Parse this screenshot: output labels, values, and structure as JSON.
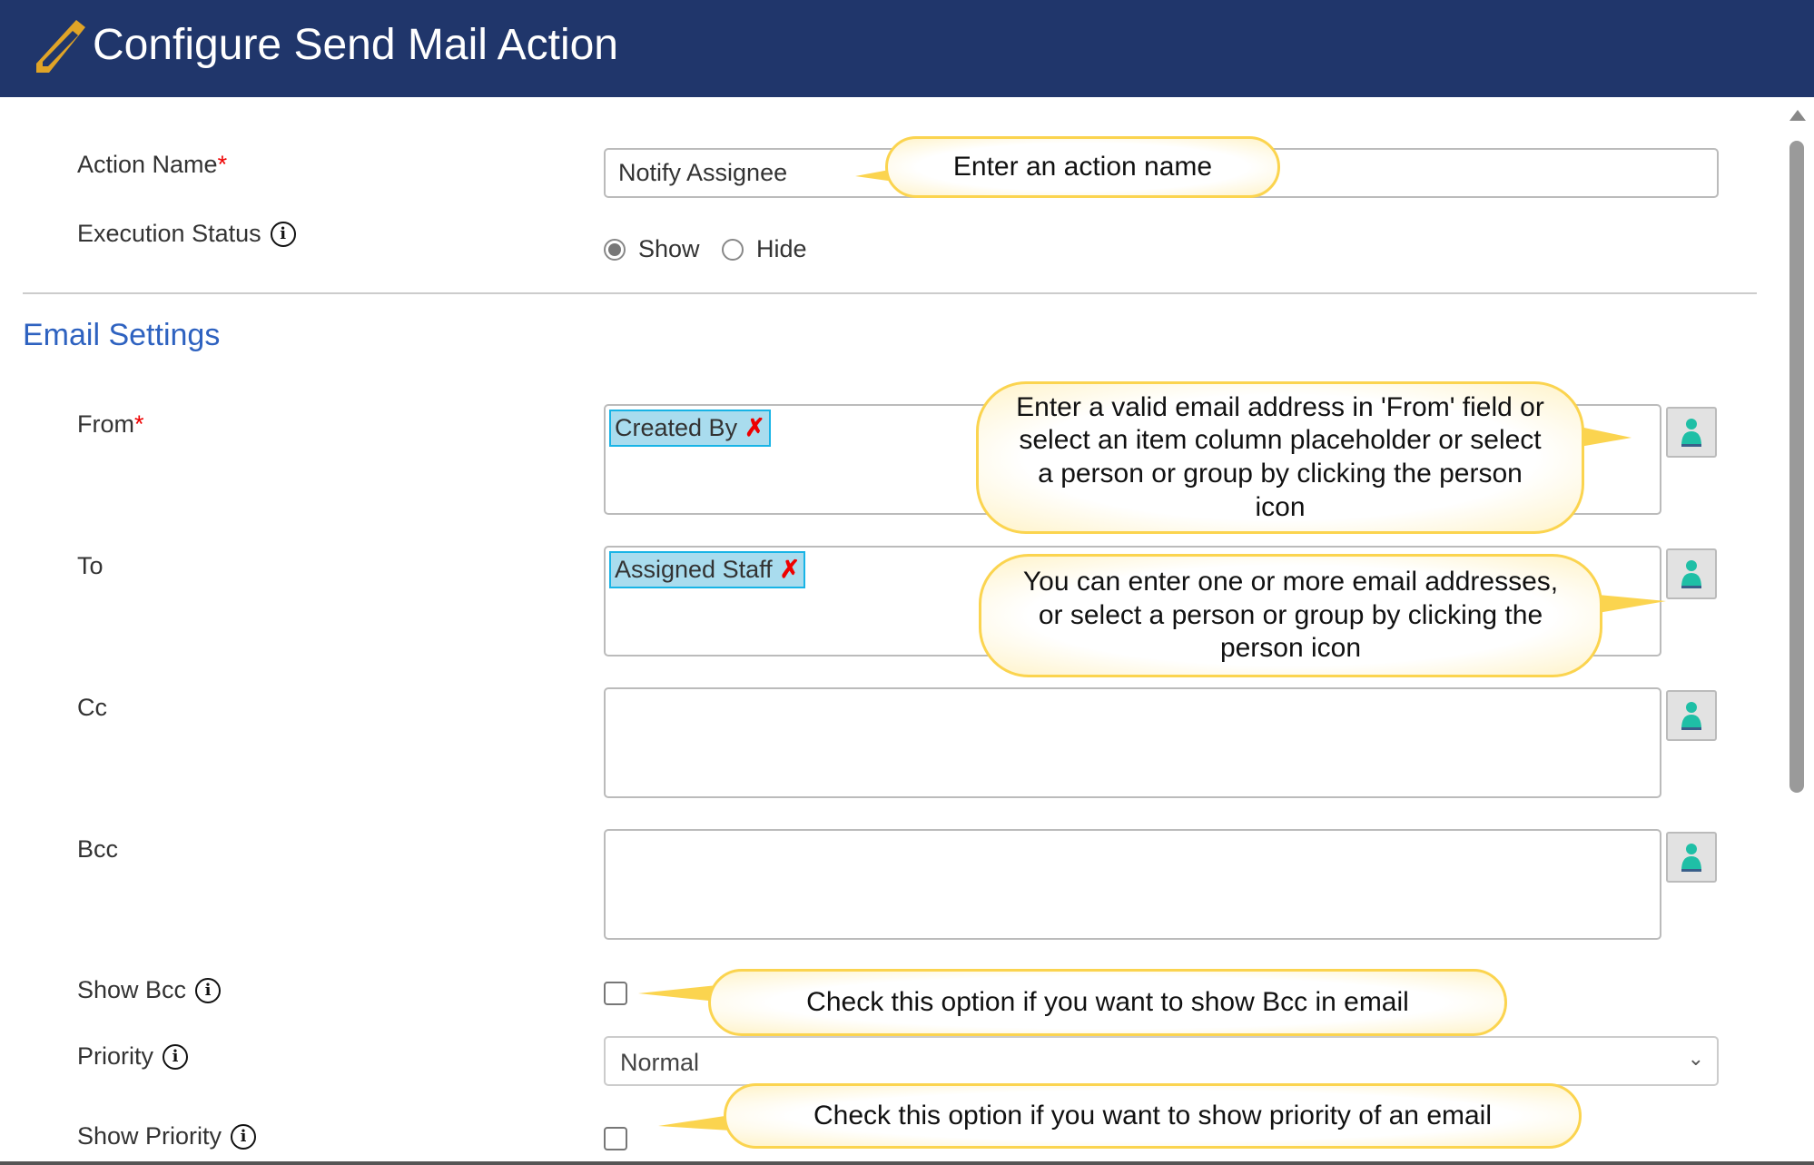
{
  "header": {
    "title": "Configure Send Mail Action",
    "icon": "pencil-icon"
  },
  "action_name": {
    "label": "Action Name",
    "required_mark": "*",
    "value": "Notify Assignee"
  },
  "execution_status": {
    "label": "Execution Status",
    "options": [
      "Show",
      "Hide"
    ],
    "selected": "Show"
  },
  "email_settings": {
    "title": "Email Settings"
  },
  "from": {
    "label": "From",
    "required_mark": "*",
    "tag": "Created By",
    "remove": "✗"
  },
  "to": {
    "label": "To",
    "tag": "Assigned Staff",
    "remove": "✗"
  },
  "cc": {
    "label": "Cc"
  },
  "bcc": {
    "label": "Bcc"
  },
  "show_bcc": {
    "label": "Show Bcc",
    "checked": false
  },
  "priority": {
    "label": "Priority",
    "value": "Normal"
  },
  "show_priority": {
    "label": "Show Priority",
    "checked": false
  },
  "callouts": {
    "action_name": "Enter an action name",
    "from": "Enter a valid email address in 'From' field or select an item column placeholder or select a person or group by clicking the person icon",
    "to": "You can enter one or more email addresses, or select a person or group by clicking the person icon",
    "show_bcc": "Check this option if you want to show Bcc in email",
    "show_priority": "Check this option if you want to show priority of an email"
  },
  "colors": {
    "header": "#20366b",
    "accent": "#2e62c0",
    "tag": "#a9dcee",
    "callout_border": "#fbd44f",
    "person_icon": "#1fbfa6"
  }
}
